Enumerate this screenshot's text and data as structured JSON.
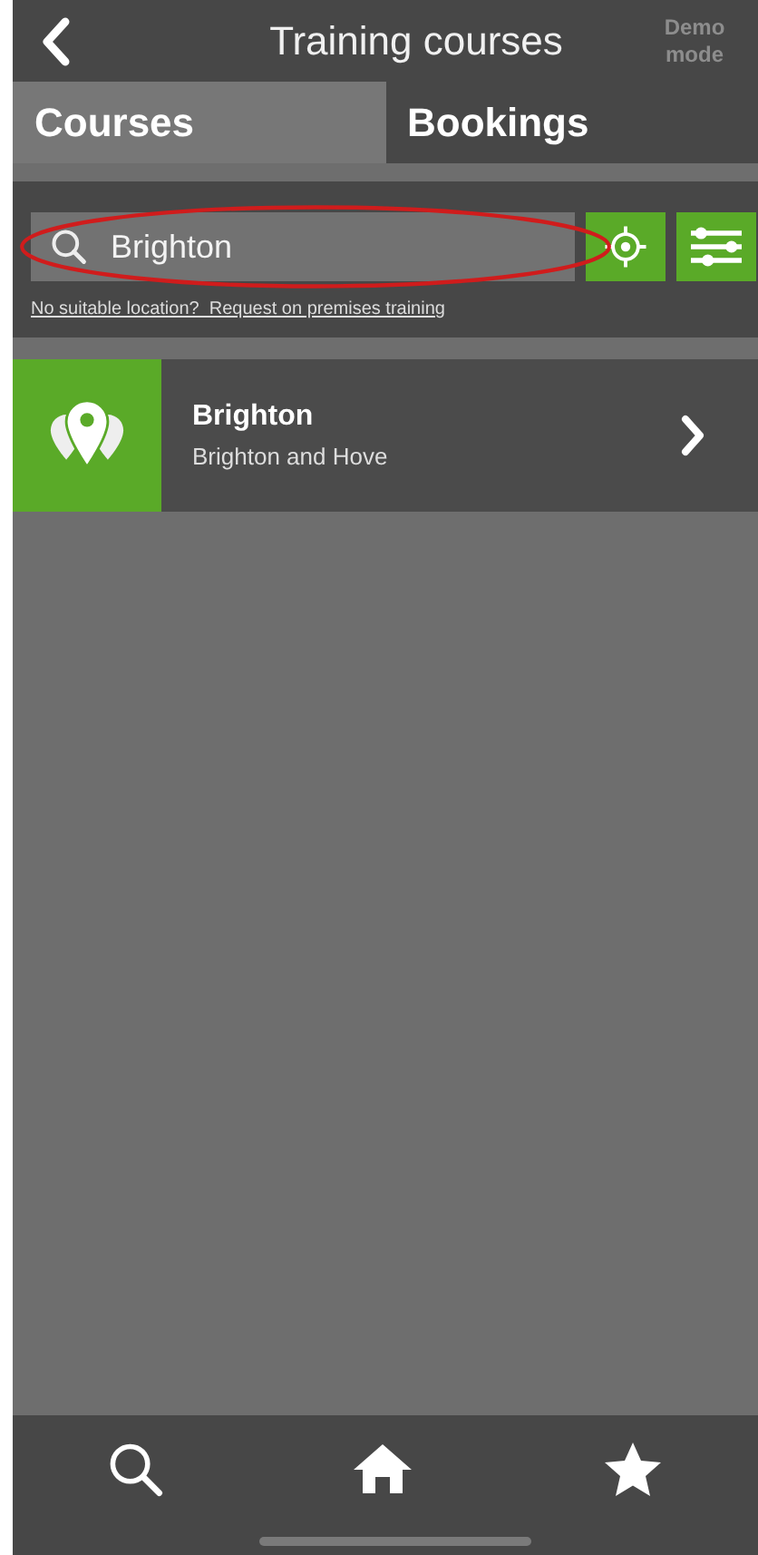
{
  "header": {
    "title": "Training courses",
    "badge": "Demo\nmode"
  },
  "tabs": [
    {
      "label": "Courses",
      "selected": true
    },
    {
      "label": "Bookings",
      "selected": false
    }
  ],
  "search": {
    "value": "Brighton",
    "highlighted": true
  },
  "link": "No suitable location?  Request on premises training",
  "results": [
    {
      "title": "Brighton",
      "subtitle": "Brighton and Hove"
    }
  ],
  "nav": [
    {
      "kind": "search"
    },
    {
      "kind": "home"
    },
    {
      "kind": "star"
    }
  ]
}
